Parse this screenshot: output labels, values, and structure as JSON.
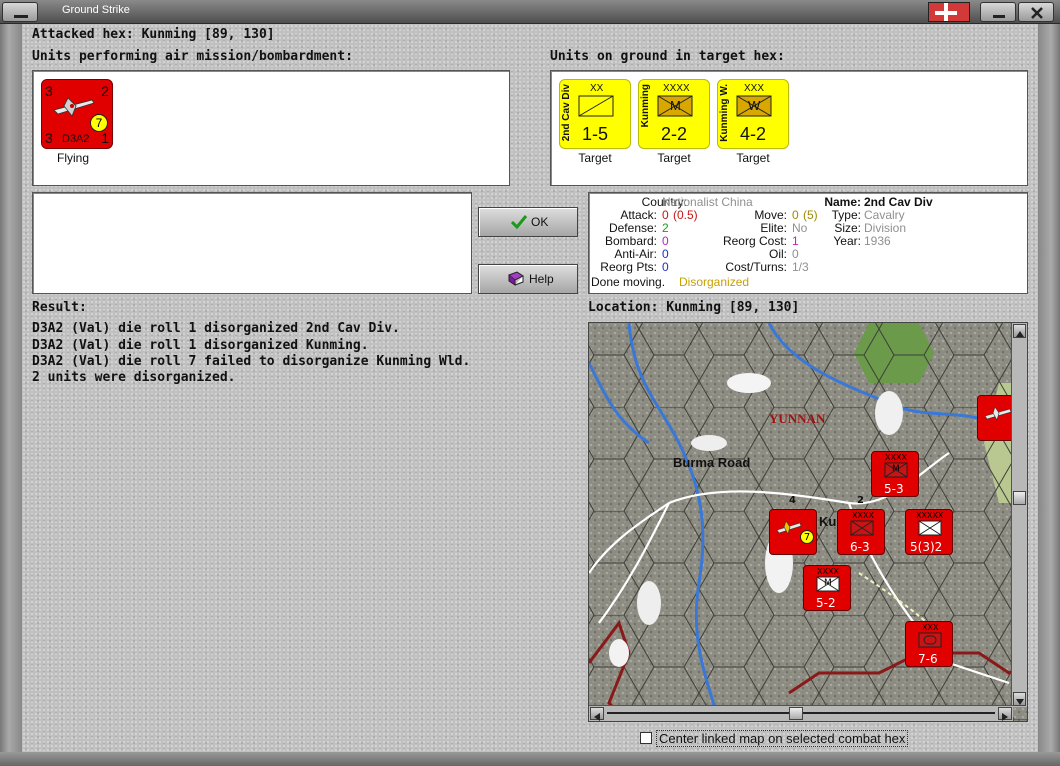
{
  "window": {
    "title": "Ground Strike"
  },
  "attacked_hex": "Attacked hex: Kunming  [89, 130]",
  "air_units": {
    "label": "Units performing air mission/bombardment:",
    "units": [
      {
        "tl": "3",
        "tr": "2",
        "bl": "3",
        "br": "1",
        "name": "D3A2",
        "badge": "7",
        "status": "Flying"
      }
    ]
  },
  "ground_units": {
    "label": "Units on ground in target hex:",
    "units": [
      {
        "side": "2nd Cav Div",
        "size": "XX",
        "value": "1-5",
        "status": "Target"
      },
      {
        "side": "Kunming",
        "size": "XXXX",
        "sym": "M",
        "value": "2-2",
        "status": "Target"
      },
      {
        "side": "Kunming W.",
        "size": "XXX",
        "sym": "W",
        "value": "4-2",
        "status": "Target"
      }
    ]
  },
  "buttons": {
    "ok": "OK",
    "help": "Help"
  },
  "info": {
    "country_k": "Country:",
    "country_v": "Nationalist China",
    "attack_k": "Attack:",
    "attack_v": "0",
    "attack_v2": "(0.5)",
    "defense_k": "Defense:",
    "defense_v": "2",
    "bombard_k": "Bombard:",
    "bombard_v": "0",
    "antiair_k": "Anti-Air:",
    "antiair_v": "0",
    "reorg_k": "Reorg Pts:",
    "reorg_v": "0",
    "move_k": "Move:",
    "move_v": "0",
    "move_v2": "(5)",
    "elite_k": "Elite:",
    "elite_v": "No",
    "reorgcost_k": "Reorg Cost:",
    "reorgcost_v": "1",
    "oil_k": "Oil:",
    "oil_v": "0",
    "cost_k": "Cost/Turns:",
    "cost_v": "1/3",
    "name_k": "Name:",
    "name_v": "2nd Cav Div",
    "type_k": "Type:",
    "type_v": "Cavalry",
    "size_k": "Size:",
    "size_v": "Division",
    "year_k": "Year:",
    "year_v": "1936",
    "done_k": "Done moving.",
    "done_v": "Disorganized"
  },
  "result": {
    "label": "Result:",
    "lines": [
      "D3A2 (Val) die roll 1 disorganized 2nd Cav Div.",
      "D3A2 (Val) die roll 1 disorganized Kunming.",
      "D3A2 (Val) die roll 7 failed to disorganize Kunming Wld.",
      "2 units were disorganized."
    ]
  },
  "location": {
    "label": "Location:  Kunming  [89, 130]",
    "map_labels": {
      "yunnan": "YUNNAN",
      "burma_road": "Burma Road",
      "kunming_partial": "Ku"
    },
    "counters": [
      {
        "value": "5-3",
        "size": "XXXX",
        "sym": "M"
      },
      {
        "value": "6-3",
        "size": "XXXX"
      },
      {
        "value": "5(3)2",
        "size": "XXXXX"
      },
      {
        "value": "5-2",
        "size": "XXXX",
        "sym": "M"
      },
      {
        "value": "7-6",
        "size": "XXX"
      }
    ],
    "stack_counts": {
      "a": "4",
      "b": "2"
    }
  },
  "center_checkbox": "Center linked map on selected combat hex",
  "colors": {
    "unit_red": "#e00000",
    "unit_yellow": "#ffff00",
    "river": "#3a78d8",
    "border": "#8a1a1a"
  }
}
